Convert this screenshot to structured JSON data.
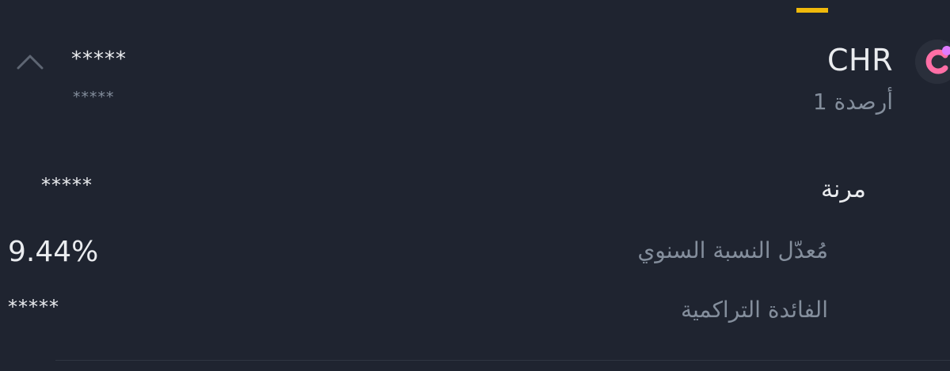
{
  "header": {
    "active_tab_indicator_color": "#f0b90b"
  },
  "asset": {
    "symbol": "CHR",
    "wallet_count": "أرصدة 1",
    "logo_icon": "chromia-logo-icon",
    "logo_colors": {
      "ring": "#ff6fa6",
      "dot": "#e07cff"
    }
  },
  "balance": {
    "main": "*****",
    "sub": "*****",
    "collapse_icon": "chevron-up-icon"
  },
  "details": {
    "flexible": {
      "label": "مرنة",
      "value": "*****"
    },
    "apr": {
      "label": "مُعدّل النسبة السنوي",
      "value": "9.44%"
    },
    "cumulative_interest": {
      "label": "الفائدة التراكمية",
      "value": "*****"
    }
  }
}
